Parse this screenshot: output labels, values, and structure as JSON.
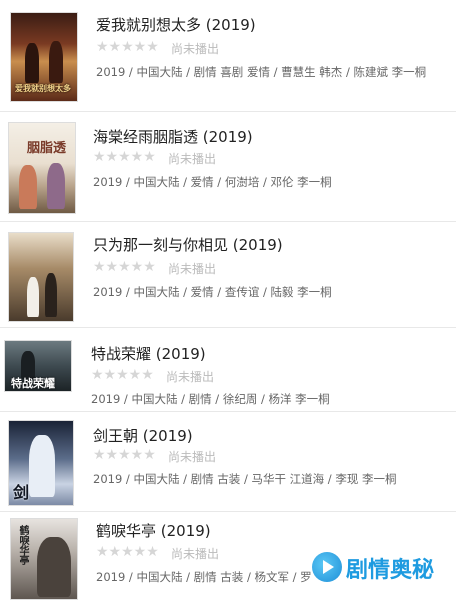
{
  "rating_text": "尚未播出",
  "stars": "★★★★★",
  "items": [
    {
      "title": "爱我就别想太多 (2019)",
      "meta": "2019 / 中国大陆 / 剧情 喜剧 爱情 / 曹慧生 韩杰 / 陈建斌 李一桐",
      "poster_text": "爱我就别想太多"
    },
    {
      "title": "海棠经雨胭脂透 (2019)",
      "meta": "2019 / 中国大陆 / 爱情 / 何澍培 / 邓伦 李一桐",
      "poster_text": "胭脂透"
    },
    {
      "title": "只为那一刻与你相见 (2019)",
      "meta": "2019 / 中国大陆 / 爱情 / 查传谊 / 陆毅 李一桐",
      "poster_text": ""
    },
    {
      "title": "特战荣耀 (2019)",
      "meta": "2019 / 中国大陆 / 剧情 / 徐纪周 / 杨洋 李一桐",
      "poster_text": "特战荣耀"
    },
    {
      "title": "剑王朝 (2019)",
      "meta": "2019 / 中国大陆 / 剧情 古装 / 马华干 江道海 / 李现 李一桐",
      "poster_text": "剑"
    },
    {
      "title": "鹤唳华亭 (2019)",
      "meta": "2019 / 中国大陆 / 剧情 古装 / 杨文军 / 罗",
      "poster_text": "鹤唳华亭"
    }
  ],
  "watermark": {
    "text": "剧情奥秘",
    "icon": "play-logo-icon"
  }
}
